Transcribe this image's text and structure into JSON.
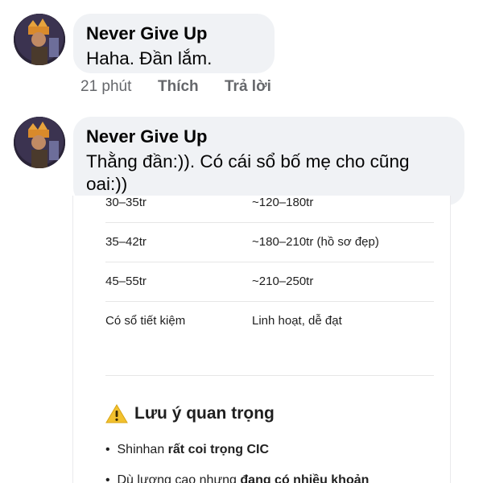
{
  "comments": [
    {
      "author": "Never Give Up",
      "text": "Haha. Đần lắm.",
      "time": "21 phút",
      "like_label": "Thích",
      "reply_label": "Trả lời"
    },
    {
      "author": "Never Give Up",
      "text_line1": "Thằng đần:)). Có cái sổ bố mẹ cho cũng",
      "text_line2": "oai:))"
    }
  ],
  "attachment": {
    "rows": [
      {
        "income": "30–35tr",
        "limit": "~120–180tr"
      },
      {
        "income": "35–42tr",
        "limit": "~180–210tr (hồ sơ đẹp)"
      },
      {
        "income": "45–55tr",
        "limit": "~210–250tr"
      },
      {
        "income": "Có sổ tiết kiệm",
        "limit": "Linh hoạt, dễ đạt"
      }
    ],
    "note_icon": "warning-icon",
    "note_title": "Lưu ý quan trọng",
    "bullet1_prefix": "Shinhan ",
    "bullet1_bold": "rất coi trọng CIC",
    "bullet2_prefix": "Dù lương cao nhưng ",
    "bullet2_bold": "đang có nhiều khoản"
  },
  "colors": {
    "bubble": "#f0f2f5",
    "meta_text": "#65676b",
    "warning": "#f2c12e"
  }
}
